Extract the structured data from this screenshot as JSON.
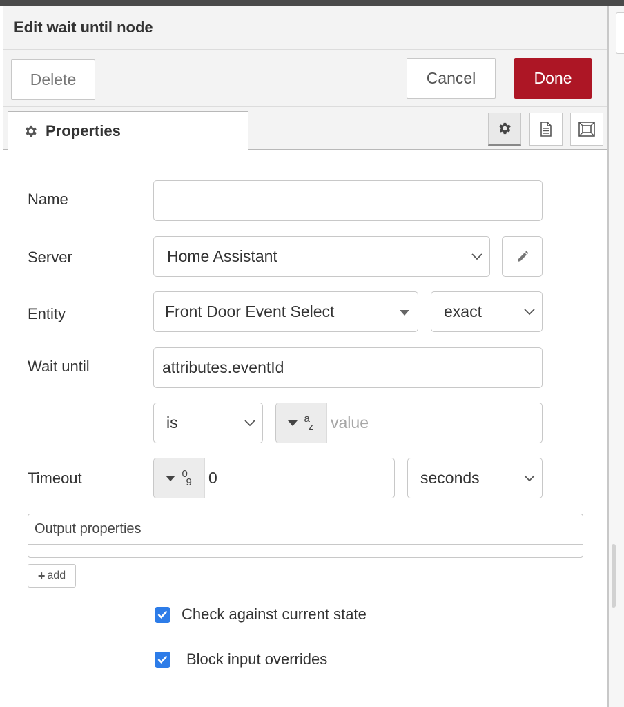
{
  "tray": {
    "title": "Edit wait until node"
  },
  "toolbar": {
    "delete_label": "Delete",
    "cancel_label": "Cancel",
    "done_label": "Done",
    "done_color": "#ad1625"
  },
  "tabs": {
    "properties_label": "Properties",
    "icons": [
      "gear-icon",
      "document-icon",
      "frame-icon"
    ]
  },
  "form": {
    "name": {
      "label": "Name",
      "value": ""
    },
    "server": {
      "label": "Server",
      "value": "Home Assistant"
    },
    "entity": {
      "label": "Entity",
      "value": "Front Door Event Select",
      "match": "exact"
    },
    "wait_until": {
      "label": "Wait until",
      "property": "attributes.eventId",
      "operator": "is",
      "value_type_glyph_top": "a",
      "value_type_glyph_bottom": "z",
      "value_placeholder": "value"
    },
    "timeout": {
      "label": "Timeout",
      "type_glyph_top": "0",
      "type_glyph_bottom": "9",
      "value": "0",
      "units": "seconds"
    },
    "output_properties": {
      "label": "Output properties",
      "add_label": "add"
    },
    "checks": {
      "check_current_state": {
        "label": "Check against current state",
        "checked": true
      },
      "block_input_overrides": {
        "label": "Block input overrides",
        "checked": true
      }
    }
  },
  "colors": {
    "accent": "#2d7ce8",
    "done": "#ad1625"
  }
}
